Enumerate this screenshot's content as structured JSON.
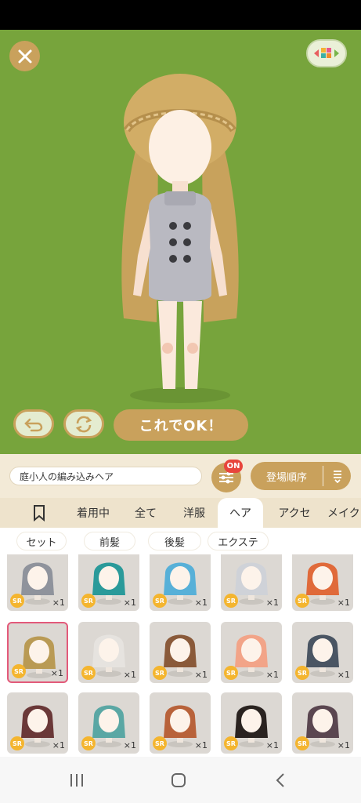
{
  "top_bar": {
    "ok_label": "これでOK！"
  },
  "controls": {
    "item_name": "庭小人の編み込みヘア",
    "filter_badge": "ON",
    "sort_label": "登場順序"
  },
  "tabs": [
    {
      "label": ""
    },
    {
      "label": "着用中"
    },
    {
      "label": "全て"
    },
    {
      "label": "洋服"
    },
    {
      "label": "ヘア"
    },
    {
      "label": "アクセ"
    },
    {
      "label": "メイク"
    }
  ],
  "subtabs": [
    {
      "label": "セット"
    },
    {
      "label": "前髪"
    },
    {
      "label": "後髪"
    },
    {
      "label": "エクステ"
    }
  ],
  "items": [
    {
      "rarity": "SR",
      "count": "×1",
      "hair": "#8f939c"
    },
    {
      "rarity": "SR",
      "count": "×1",
      "hair": "#2a9a9a"
    },
    {
      "rarity": "SR",
      "count": "×1",
      "hair": "#57b0d8"
    },
    {
      "rarity": "SR",
      "count": "×1",
      "hair": "#cfd2d8"
    },
    {
      "rarity": "SR",
      "count": "×1",
      "hair": "#e06a3a"
    },
    {
      "rarity": "SR",
      "count": "×1",
      "hair": "#b99a54"
    },
    {
      "rarity": "SR",
      "count": "×1",
      "hair": "#e6e3df"
    },
    {
      "rarity": "SR",
      "count": "×1",
      "hair": "#8a5a3a"
    },
    {
      "rarity": "SR",
      "count": "×1",
      "hair": "#f2a488"
    },
    {
      "rarity": "SR",
      "count": "×1",
      "hair": "#4a5563"
    },
    {
      "rarity": "SR",
      "count": "×1",
      "hair": "#6a3838"
    },
    {
      "rarity": "SR",
      "count": "×1",
      "hair": "#5aa7a4"
    },
    {
      "rarity": "SR",
      "count": "×1",
      "hair": "#b8623a"
    },
    {
      "rarity": "SR",
      "count": "×1",
      "hair": "#2a2320"
    },
    {
      "rarity": "SR",
      "count": "×1",
      "hair": "#5a4650"
    }
  ],
  "colors": {
    "stage": "#77a43c",
    "accent": "#c9a15c",
    "selected": "#e35a7a",
    "badge": "#e8453c"
  },
  "icons": {
    "close": "close-icon",
    "layout": "layout-toggle-icon",
    "undo": "undo-icon",
    "rotate": "rotate-icon",
    "filter": "filter-sliders-icon",
    "sort": "sort-icon",
    "bookmark": "bookmark-icon"
  }
}
